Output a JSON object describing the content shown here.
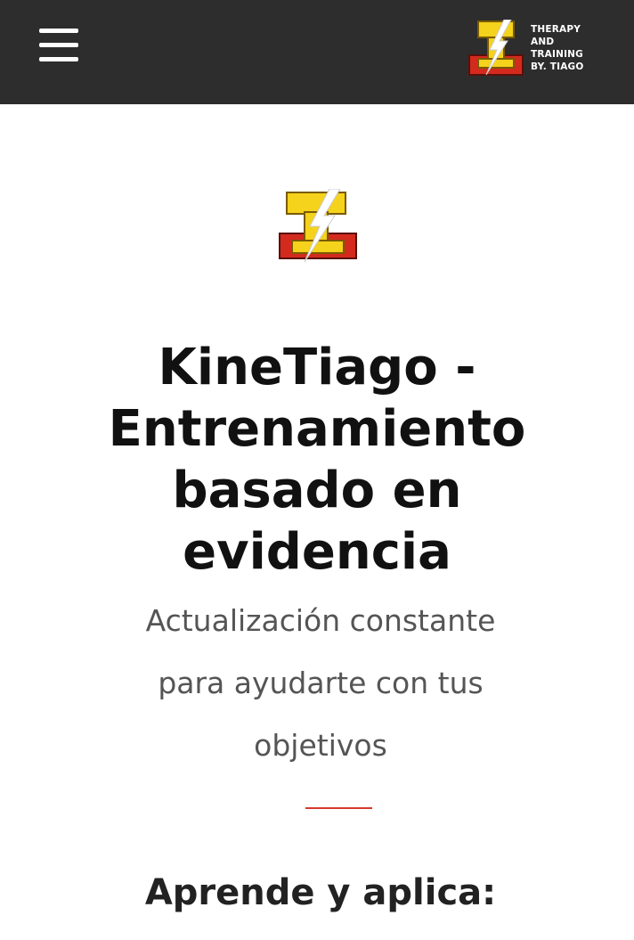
{
  "header": {
    "menu_icon": "hamburger-menu-icon",
    "logo_icon": "tt-lightning-logo-icon",
    "logo_lines": [
      "THERAPY",
      "AND",
      "TRAINING",
      "BY. TIAGO"
    ]
  },
  "hero": {
    "logo_icon": "tt-lightning-logo-icon",
    "title_lines": [
      "KineTiago -",
      "Entrenamiento",
      "basado en",
      "evidencia"
    ],
    "subtitle_lines": [
      "Actualización constante",
      "para ayudarte con tus",
      "objetivos"
    ]
  },
  "section": {
    "heading": "Aprende y aplica:"
  },
  "colors": {
    "header_bg": "#2d2d2d",
    "logo_yellow": "#f5d21c",
    "logo_red": "#d42a1e",
    "divider": "#d63a2c",
    "title": "#111111",
    "subtitle": "#555555"
  }
}
